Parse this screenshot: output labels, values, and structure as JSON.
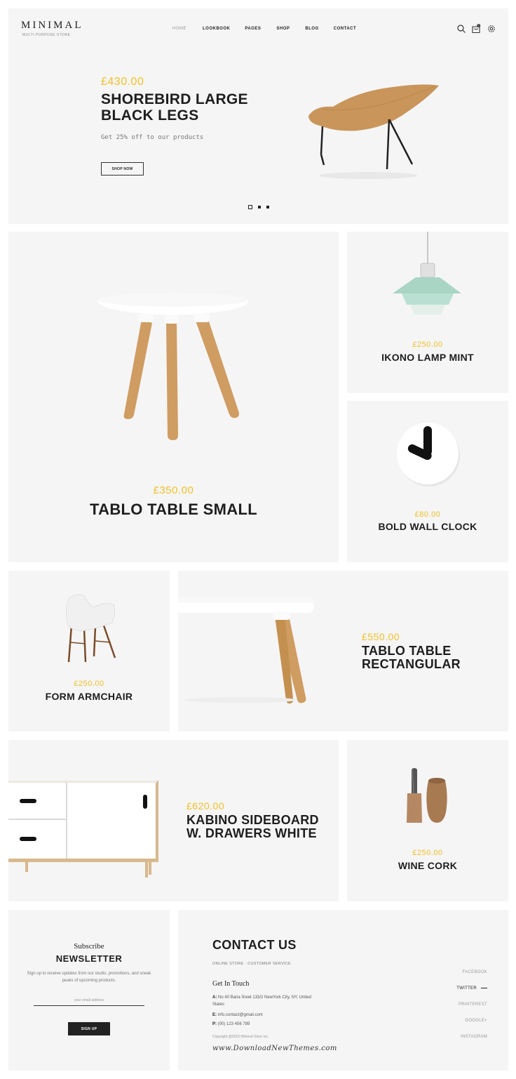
{
  "header": {
    "logo": "MINIMAL",
    "tagline": "MULTI PURPOSE STORE",
    "nav": [
      "HOME",
      "LOOKBOOK",
      "PAGES",
      "SHOP",
      "BLOG",
      "CONTACT"
    ],
    "cart_count": "0"
  },
  "hero": {
    "price": "£430.00",
    "title_line1": "SHOREBIRD LARGE",
    "title_line2": "BLACK LEGS",
    "subtitle": "Get 25% off to our products",
    "button": "SHOP NOW",
    "slide_count": 3,
    "active_slide": 1
  },
  "products": [
    {
      "price": "£350.00",
      "name": "TABLO TABLE SMALL"
    },
    {
      "price": "£250.00",
      "name": "IKONO LAMP MINT"
    },
    {
      "price": "£80.00",
      "name": "BOLD WALL CLOCK"
    },
    {
      "price": "£250.00",
      "name": "FORM ARMCHAIR"
    },
    {
      "price": "£550.00",
      "name_line1": "TABLO TABLE",
      "name_line2": "RECTANGULAR"
    },
    {
      "price": "£620.00",
      "name_line1": "KABINO SIDEBOARD",
      "name_line2": "W. DRAWERS WHITE"
    },
    {
      "price": "£250.00",
      "name": "WINE CORK"
    }
  ],
  "newsletter": {
    "pre_title": "Subscribe",
    "title": "NEWSLETTER",
    "text": "Sign up to receive updates from our studio, promotions, and sneak peaks of upcoming products.",
    "placeholder": "your email address",
    "button": "SIGN UP"
  },
  "contact": {
    "title": "CONTACT US",
    "subtitle": "ONLINE STORE - CUSTOMER SERVICE",
    "get_in_touch": "Get In Touch",
    "address_label": "A:",
    "address": "No 40 Baria Sreet 133/2 NewYork City, NY, United States",
    "email_label": "E:",
    "email": "info.contact@gmail.com",
    "phone_label": "P:",
    "phone": "(00) 123 456 789",
    "copyright": "Copyright @2016 Minimal Store Inc.",
    "watermark": "www.DownloadNewThemes.com",
    "social": [
      "FACEBOOK",
      "TWITTER",
      "PRINTEREST",
      "GOOGLE+",
      "INSTAGRAM"
    ]
  },
  "colors": {
    "accent": "#f0c02a",
    "panel": "#f5f5f5",
    "text": "#1e1e1e"
  }
}
